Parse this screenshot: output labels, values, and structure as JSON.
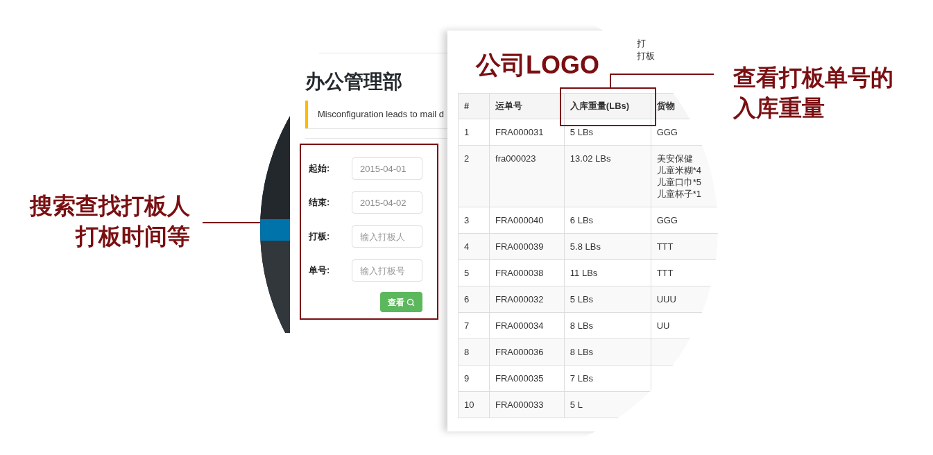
{
  "callouts": [
    {
      "lines": [
        "搜索查找打板人",
        "打板时间等"
      ]
    },
    {
      "lines": [
        "查看打板单号的",
        "入库重量"
      ]
    }
  ],
  "sidebar": {
    "items": [
      {
        "selected": false
      },
      {
        "selected": true
      },
      {
        "selected": false
      }
    ]
  },
  "search_panel": {
    "title": "办公管理部",
    "notice": "Misconfiguration leads to mail d",
    "fields": [
      {
        "label": "起始:",
        "value": "2015-04-01"
      },
      {
        "label": "结束:",
        "value": "2015-04-02"
      },
      {
        "label": "打板:",
        "placeholder": "输入打板人"
      },
      {
        "label": "单号:",
        "placeholder": "输入打板号"
      }
    ],
    "button": "查看"
  },
  "table_panel": {
    "logo": "公司LOGO",
    "top_notes": [
      "打",
      "打板"
    ],
    "columns": [
      "#",
      "运单号",
      "入库重量(LBs)",
      "货物"
    ],
    "rows": [
      [
        "1",
        "FRA000031",
        "5 LBs",
        "GGG"
      ],
      [
        "2",
        "fra000023",
        "13.02 LBs",
        [
          "美安保健",
          "儿童米糊*4",
          "儿童口巾*5",
          "儿童杯子*1"
        ]
      ],
      [
        "3",
        "FRA000040",
        "6 LBs",
        "GGG"
      ],
      [
        "4",
        "FRA000039",
        "5.8 LBs",
        "TTT"
      ],
      [
        "5",
        "FRA000038",
        "11 LBs",
        "TTT"
      ],
      [
        "6",
        "FRA000032",
        "5 LBs",
        "UUU"
      ],
      [
        "7",
        "FRA000034",
        "8 LBs",
        "UU"
      ],
      [
        "8",
        "FRA000036",
        "8 LBs"
      ],
      [
        "9",
        "FRA000035",
        "7 LBs"
      ],
      [
        "10",
        "FRA000033",
        "5 L"
      ]
    ]
  }
}
